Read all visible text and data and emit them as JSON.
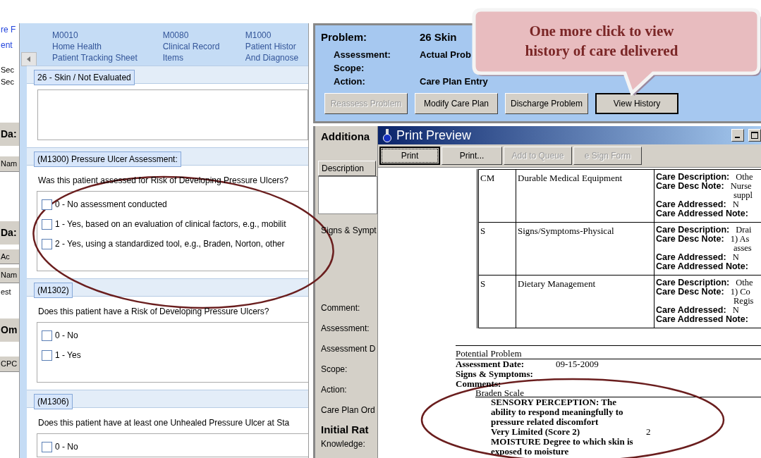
{
  "left_strip": {
    "items": [
      {
        "text": "re F",
        "kind": "link"
      },
      {
        "text": "ent",
        "kind": "link"
      },
      {
        "text": "Sec",
        "kind": "label"
      },
      {
        "text": "Sec",
        "kind": "label"
      },
      {
        "text": "Da:",
        "kind": "heading"
      },
      {
        "text": "Nam",
        "kind": "column"
      },
      {
        "text": "Da:",
        "kind": "heading"
      },
      {
        "text": "Ac",
        "kind": "column"
      },
      {
        "text": "Nam",
        "kind": "column"
      },
      {
        "text": "est",
        "kind": "label"
      },
      {
        "text": "Om",
        "kind": "heading"
      },
      {
        "text": "CPC",
        "kind": "column"
      }
    ]
  },
  "form": {
    "tabs": [
      {
        "code": "M0010",
        "lines": [
          "Home  Health",
          "Patient Tracking Sheet"
        ]
      },
      {
        "code": "M0080",
        "lines": [
          "Clinical  Record",
          "Items"
        ]
      },
      {
        "code": "M1000",
        "lines": [
          "Patient  Histor",
          "And Diagnose"
        ]
      }
    ],
    "sections": [
      {
        "title": "26 - Skin / Not Evaluated",
        "kind": "textarea"
      },
      {
        "title": "(M1300) Pressure Ulcer Assessment:",
        "kind": "choices",
        "question": "Was this patient assessed for Risk of Developing Pressure Ulcers?",
        "options": [
          {
            "label": "0 - No assessment conducted",
            "checked": false
          },
          {
            "label": "1 - Yes, based on an evaluation of clinical factors, e.g., mobilit",
            "checked": false
          },
          {
            "label": "2 - Yes, using a standardized tool, e.g., Braden, Norton, other",
            "checked": false
          }
        ]
      },
      {
        "title": "(M1302)",
        "kind": "choices",
        "question": "Does this patient have a Risk of Developing Pressure Ulcers?",
        "options": [
          {
            "label": "0 - No",
            "checked": false
          },
          {
            "label": "1 - Yes",
            "checked": false
          }
        ]
      },
      {
        "title": "(M1306)",
        "kind": "choices",
        "question": "Does this patient have at least one Unhealed Pressure Ulcer at Sta",
        "options": [
          {
            "label": "0 - No",
            "checked": false
          }
        ]
      }
    ]
  },
  "problem": {
    "fields": [
      {
        "label": "Problem:",
        "value": "26 Skin",
        "kind": "main"
      },
      {
        "label": "Assessment:",
        "value": "Actual Prob",
        "kind": "sub"
      },
      {
        "label": "Scope:",
        "kind": "sub"
      },
      {
        "label": "Action:",
        "value": "Care Plan Entry",
        "kind": "sub"
      }
    ],
    "buttons": [
      {
        "label": "Reassess Problem",
        "disabled": true,
        "selected": false
      },
      {
        "label": "Modify Care Plan",
        "disabled": false,
        "selected": false
      },
      {
        "label": "Discharge Problem",
        "disabled": false,
        "selected": false
      },
      {
        "label": "View History",
        "disabled": false,
        "selected": true
      }
    ]
  },
  "callout": {
    "text": "One more click to view history of care delivered"
  },
  "background_form": {
    "section": "Additiona",
    "column": "Description",
    "labels": [
      "Signs & Sympt",
      "Comment:",
      "Assessment:",
      "Assessment D",
      "Scope:",
      "Action:",
      "Care Plan Ord"
    ],
    "section_2": "Initial Rat",
    "labels_2": [
      "Knowledge:"
    ]
  },
  "print_preview": {
    "title": "Print Preview",
    "buttons": [
      {
        "label": "Print",
        "disabled": false,
        "focused": true
      },
      {
        "label": "Print...",
        "disabled": false,
        "focused": false
      },
      {
        "label": "Add to Queue",
        "disabled": true,
        "focused": false
      },
      {
        "label": "e Sign Form",
        "disabled": true,
        "focused": false
      }
    ],
    "table_rows": [
      {
        "code": "CM",
        "name": "Durable Medical Equipment",
        "details": [
          {
            "label": "Care Description:",
            "values": [
              "Othe"
            ]
          },
          {
            "label": "Care Desc Note:",
            "values": [
              "Nurse",
              "suppl"
            ]
          },
          {
            "label": "Care Addressed:",
            "values": [
              "N"
            ]
          },
          {
            "label": "Care Addressed Note:"
          }
        ]
      },
      {
        "code": "S",
        "name": "Signs/Symptoms-Physical",
        "details": [
          {
            "label": "Care Description:",
            "values": [
              "Drai"
            ]
          },
          {
            "label": "Care Desc Note:",
            "values": [
              "1) As",
              "asses"
            ]
          },
          {
            "label": "Care Addressed:",
            "values": [
              "N"
            ]
          },
          {
            "label": "Care Addressed Note:"
          }
        ]
      },
      {
        "code": "S",
        "name": "Dietary Management",
        "details": [
          {
            "label": "Care Description:",
            "values": [
              "Othe"
            ]
          },
          {
            "label": "Care Desc Note:",
            "values": [
              "1) Co",
              "Regis"
            ]
          },
          {
            "label": "Care Addressed:",
            "values": [
              "N"
            ]
          },
          {
            "label": "Care Addressed Note:"
          }
        ]
      }
    ],
    "problem": {
      "heading": "Potential Problem",
      "fields": [
        {
          "label": "Assessment Date:",
          "value": "09-15-2009"
        },
        {
          "label": "Signs & Symptoms:"
        },
        {
          "label": "Comments:"
        }
      ],
      "scale": "Braden Scale",
      "items": [
        {
          "text": "SENSORY PERCEPTION:  The ability to respond meaningfully to pressure related discomfort"
        },
        {
          "text": "Very Limited (Score 2)",
          "score": "2"
        },
        {
          "text": "MOISTURE  Degree to which skin is exposed to moisture"
        }
      ]
    }
  }
}
